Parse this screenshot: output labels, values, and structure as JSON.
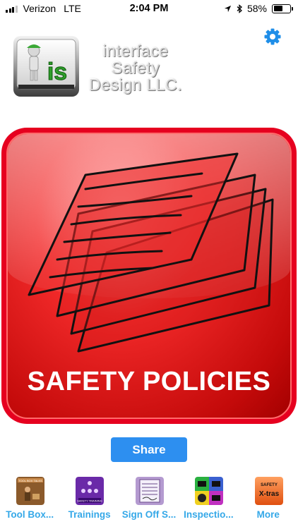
{
  "status_bar": {
    "carrier": "Verizon",
    "network": "LTE",
    "time": "2:04 PM",
    "battery_percent_text": "58%",
    "battery_level": 0.58,
    "icons": [
      "signal-icon",
      "location-arrow-icon",
      "bluetooth-icon",
      "battery-icon"
    ]
  },
  "header": {
    "company_line1": "interface",
    "company_line2": "Safety",
    "company_line3": "Design LLC.",
    "logo_letters": "is",
    "settings_icon": "gear-icon"
  },
  "main_tile": {
    "label": "SAFETY POLICIES",
    "icon": "documents-stack-icon"
  },
  "share_label": "Share",
  "tabs": [
    {
      "label": "Tool Box...",
      "icon": "toolbox-talks-icon",
      "badge": "TOOL BOX TALKS",
      "color": "#8b5a2b"
    },
    {
      "label": "Trainings",
      "icon": "safety-training-icon",
      "badge": "SAFETY TRAINING",
      "color": "#6a2aa8"
    },
    {
      "label": "Sign Off S...",
      "icon": "sign-off-sheet-icon",
      "badge": "",
      "color": "#b49ad0"
    },
    {
      "label": "Inspectio...",
      "icon": "inspections-icon",
      "badge": "",
      "color": "#2ab040"
    },
    {
      "label": "More",
      "icon": "safety-xtras-icon",
      "badge": "SAFETY",
      "badge2": "X-tras",
      "color": "#f07030"
    }
  ],
  "colors": {
    "accent": "#2d8ff0",
    "tab_label": "#35a8e8",
    "tile_red": "#e6001f"
  }
}
